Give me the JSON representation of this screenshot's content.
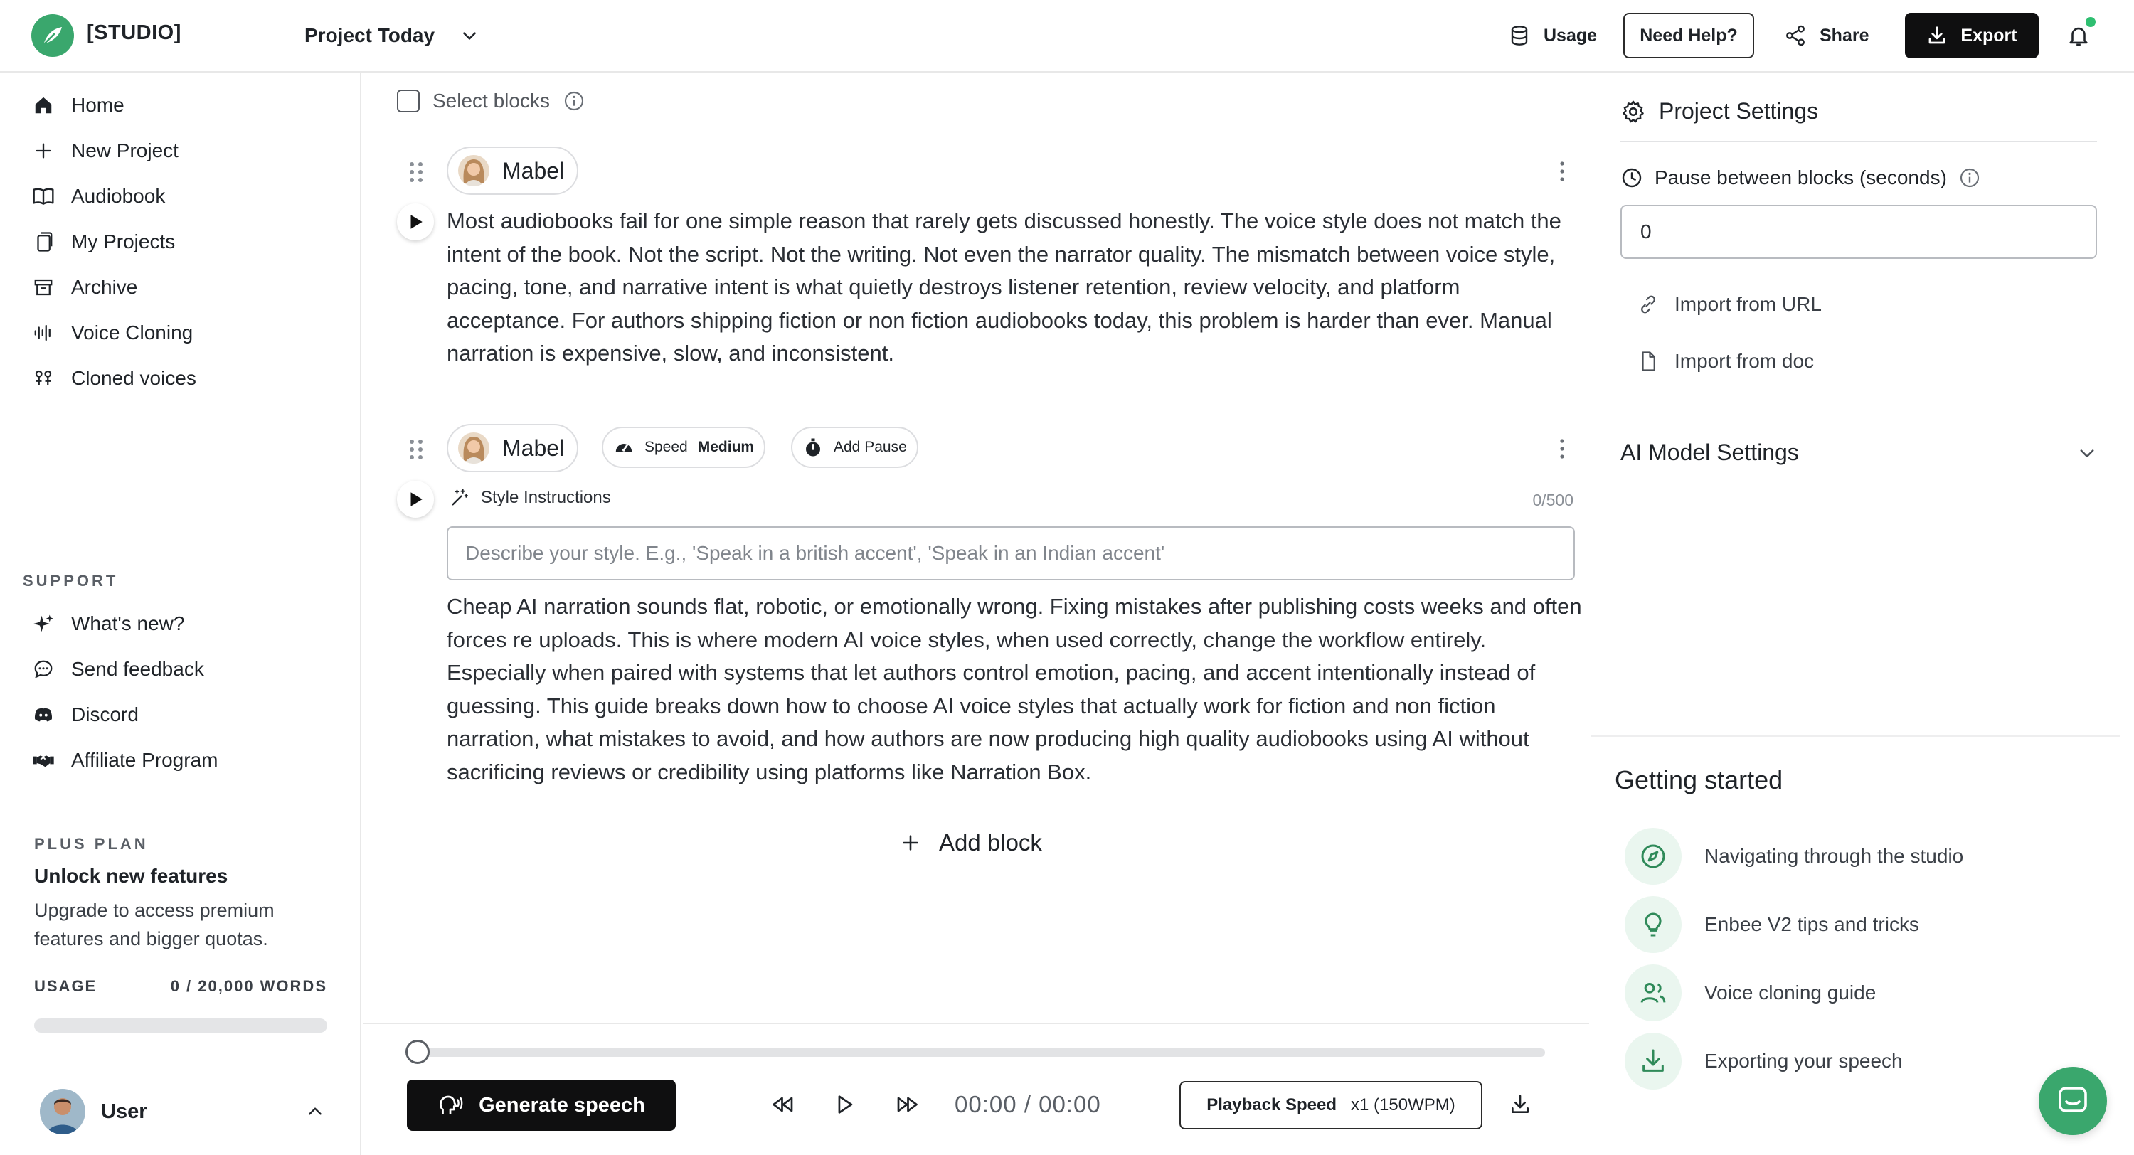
{
  "app": {
    "brand": "[STUDIO]",
    "project_name": "Project Today"
  },
  "header": {
    "usage_label": "Usage",
    "help_label": "Need Help?",
    "share_label": "Share",
    "export_label": "Export"
  },
  "sidebar": {
    "nav": [
      {
        "label": "Home",
        "icon": "home-icon"
      },
      {
        "label": "New Project",
        "icon": "plus-icon"
      },
      {
        "label": "Audiobook",
        "icon": "book-icon"
      },
      {
        "label": "My Projects",
        "icon": "copy-icon"
      },
      {
        "label": "Archive",
        "icon": "archive-icon"
      },
      {
        "label": "Voice Cloning",
        "icon": "waveform-icon"
      },
      {
        "label": "Cloned voices",
        "icon": "voices-icon"
      }
    ],
    "support_label": "SUPPORT",
    "support": [
      {
        "label": "What's new?",
        "icon": "sparkle-icon"
      },
      {
        "label": "Send feedback",
        "icon": "chat-bubble-icon"
      },
      {
        "label": "Discord",
        "icon": "discord-icon"
      },
      {
        "label": "Affiliate Program",
        "icon": "handshake-icon"
      }
    ],
    "plan": {
      "label": "PLUS PLAN",
      "title": "Unlock new features",
      "description": "Upgrade to access premium features and bigger quotas.",
      "usage_label": "USAGE",
      "usage_value": "0 / 20,000 WORDS",
      "usage_fraction": 0
    },
    "user_name": "User"
  },
  "editor": {
    "select_blocks_label": "Select blocks",
    "blocks": [
      {
        "voice": "Mabel",
        "text": "Most audiobooks fail for one simple reason that rarely gets discussed honestly. The voice style does not match the intent of the book. Not the script. Not the writing. Not even the narrator quality. The mismatch between voice style, pacing, tone, and narrative intent is what quietly destroys listener retention, review velocity, and platform acceptance. For authors shipping fiction or non fiction audiobooks today, this problem is harder than ever. Manual narration is expensive, slow, and inconsistent."
      },
      {
        "voice": "Mabel",
        "speed_label": "Speed",
        "speed_value": "Medium",
        "add_pause_label": "Add Pause",
        "style_label": "Style Instructions",
        "style_count": "0/500",
        "style_placeholder": "Describe your style. E.g., 'Speak in a british accent', 'Speak in an Indian accent'",
        "text": "Cheap AI narration sounds flat, robotic, or emotionally wrong. Fixing mistakes after publishing costs weeks and often forces re uploads. This is where modern AI voice styles, when used correctly, change the workflow entirely. Especially when paired with systems that let authors control emotion, pacing, and accent intentionally instead of guessing. This guide breaks down how to choose AI voice styles that actually work for fiction and non fiction narration, what mistakes to avoid, and how authors are now producing high quality audiobooks using AI without sacrificing reviews or credibility using platforms like Narration Box."
      }
    ],
    "add_block_label": "Add block"
  },
  "player": {
    "generate_label": "Generate speech",
    "time": "00:00 / 00:00",
    "progress_fraction": 0,
    "speed_label": "Playback Speed",
    "speed_value": "x1 (150WPM)"
  },
  "settings": {
    "title": "Project Settings",
    "pause_label": "Pause between blocks (seconds)",
    "pause_value": "0",
    "import_url_label": "Import from URL",
    "import_doc_label": "Import from doc",
    "ai_model_label": "AI Model Settings"
  },
  "getting_started": {
    "title": "Getting started",
    "items": [
      {
        "label": "Navigating through the studio",
        "icon": "compass-icon"
      },
      {
        "label": "Enbee V2 tips and tricks",
        "icon": "lightbulb-icon"
      },
      {
        "label": "Voice cloning guide",
        "icon": "users-icon"
      },
      {
        "label": "Exporting your speech",
        "icon": "download-icon"
      }
    ]
  },
  "colors": {
    "accent": "#3aa76d",
    "dark_button": "#0f0f10",
    "border": "#dcdde0"
  }
}
